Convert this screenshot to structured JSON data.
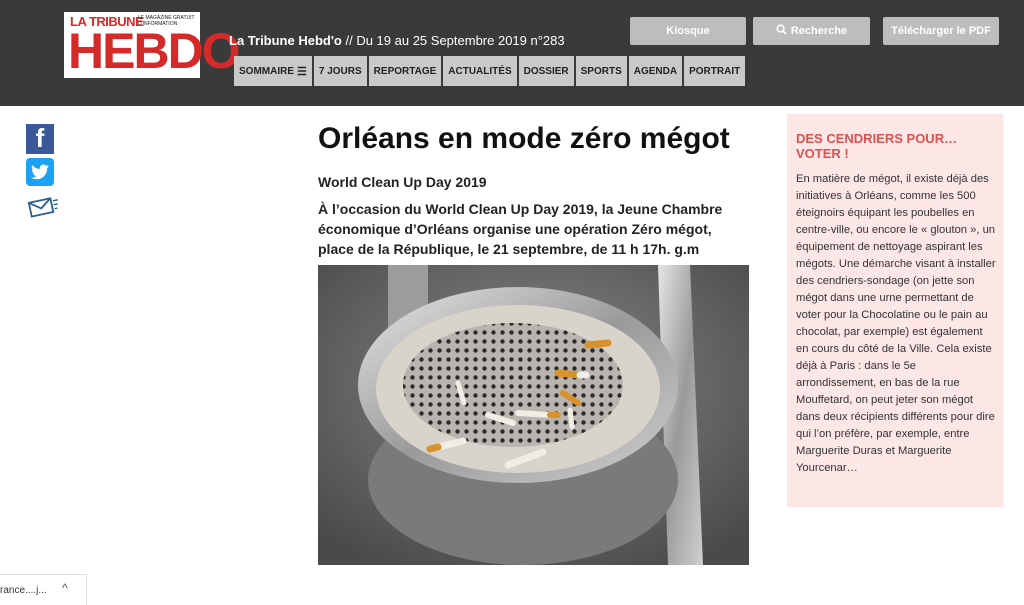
{
  "header": {
    "logo": {
      "small_top": "LA TRIBUNE",
      "la": "LA",
      "tagline": "le magazine gratuit d'information",
      "big": "HEBDO"
    },
    "issue_name": "La Tribune Hebd'o",
    "issue_text": " // Du 19 au 25 Septembre 2019 n°283",
    "buttons": {
      "kiosque": "Kiosque",
      "recherche": "Recherche",
      "pdf": "Télécharger le PDF"
    },
    "nav": [
      "SOMMAIRE",
      "7 JOURS",
      "REPORTAGE",
      "ACTUALITÉS",
      "DOSSIER",
      "SPORTS",
      "AGENDA",
      "PORTRAIT"
    ]
  },
  "icons": {
    "facebook": "f",
    "twitter": "🐦",
    "search": "🔍",
    "menu": "☰"
  },
  "article": {
    "title": "Orléans en mode zéro mégot",
    "subtitle": "World Clean Up Day 2019",
    "lead": "À l’occasion du World Clean Up Day 2019, la Jeune Chambre économique d’Orléans organise une opération Zéro mégot, place de la République, le 21 septembre, de 11 h 17h. g.m"
  },
  "aside": {
    "heading": "DES CENDRIERS POUR… VOTER !",
    "body": "En matière de mégot, il existe déjà des initiatives à Orléans, comme les 500 éteignoirs équipant les poubelles en centre-ville, ou encore le « glouton », un équipement de nettoyage aspirant les mégots. Une démarche visant à installer des cendriers-sondage (on jette son mégot dans une urne permettant de voter pour la Chocolatine ou le pain au chocolat, par exemple) est également en cours du côté de la Ville. Cela existe déjà à Paris : dans le 5e arrondissement, en bas de la rue Mouffetard, on peut jeter son mégot dans deux récipients différents pour dire qui l’on préfère, par exemple, entre Marguerite Duras et Marguerite Yourcenar…"
  },
  "download_bar": {
    "filename": "rance....j...",
    "caret": "^"
  },
  "colors": {
    "header_bg": "#3a3a3a",
    "logo_red": "#d42a2a",
    "aside_bg": "#fde6e6",
    "aside_heading": "#d9534f",
    "facebook": "#3b5998",
    "twitter": "#1da1f2"
  }
}
